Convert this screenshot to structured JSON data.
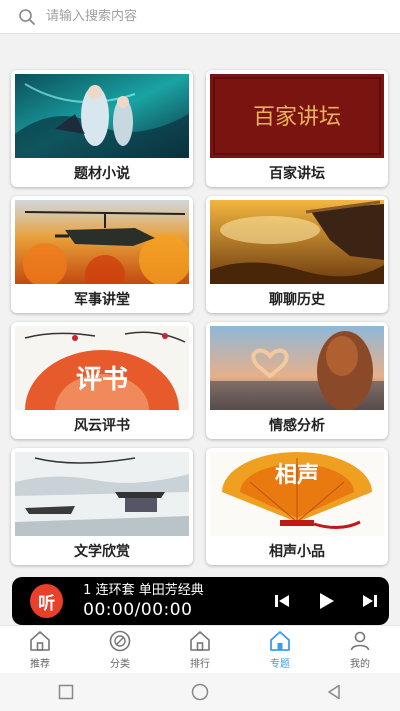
{
  "search": {
    "placeholder": "请输入搜索内容"
  },
  "categories": [
    {
      "label": "题材小说"
    },
    {
      "label": "百家讲坛",
      "art_text": "百家讲坛"
    },
    {
      "label": "军事讲堂"
    },
    {
      "label": "聊聊历史"
    },
    {
      "label": "风云评书",
      "art_text": "评书"
    },
    {
      "label": "情感分析"
    },
    {
      "label": "文学欣赏"
    },
    {
      "label": "相声小品",
      "art_text": "相声"
    }
  ],
  "player": {
    "logo": "听",
    "title": "1 连环套  单田芳经典",
    "time": "00:00/00:00",
    "controls": [
      "prev-icon",
      "play-icon",
      "next-icon"
    ]
  },
  "tabbar": {
    "items": [
      {
        "label": "推荐",
        "icon": "home-icon",
        "active": false
      },
      {
        "label": "分类",
        "icon": "disc-icon",
        "active": false
      },
      {
        "label": "排行",
        "icon": "home-icon",
        "active": false
      },
      {
        "label": "专题",
        "icon": "home-icon",
        "active": true
      },
      {
        "label": "我的",
        "icon": "person-icon",
        "active": false
      }
    ]
  },
  "colors": {
    "accent": "#3b9ee9",
    "player_logo": "#e8402a",
    "player_bg": "#000000"
  }
}
